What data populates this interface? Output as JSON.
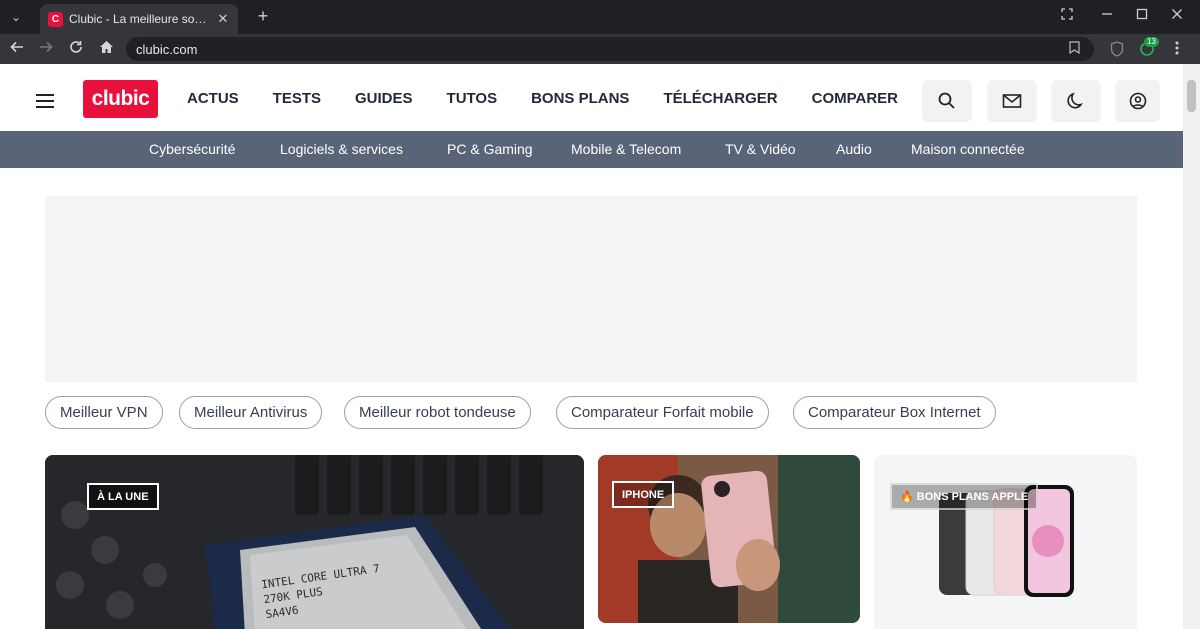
{
  "browser": {
    "tab_title": "Clubic - La meilleure so…",
    "tab_favicon_letter": "C",
    "url": "clubic.com",
    "extension_badge": "13"
  },
  "header": {
    "logo": "clubic",
    "nav": [
      "ACTUS",
      "TESTS",
      "GUIDES",
      "TUTOS",
      "BONS PLANS",
      "TÉLÉCHARGER",
      "COMPARER"
    ]
  },
  "categories": [
    "Cybersécurité",
    "Logiciels & services",
    "PC & Gaming",
    "Mobile & Telecom",
    "TV & Vidéo",
    "Audio",
    "Maison connectée"
  ],
  "quick_links": [
    "Meilleur VPN",
    "Meilleur Antivirus",
    "Meilleur robot tondeuse",
    "Comparateur Forfait mobile",
    "Comparateur Box Internet"
  ],
  "cards": [
    {
      "badge": "À LA UNE",
      "chip_lines": [
        "INTEL CORE ULTRA 7",
        "270K PLUS",
        "SA4V6"
      ]
    },
    {
      "badge": "IPHONE"
    },
    {
      "badge": "🔥 BONS PLANS APPLE"
    }
  ],
  "colors": {
    "brand": "#e8113c",
    "catbar": "#5a6478"
  }
}
